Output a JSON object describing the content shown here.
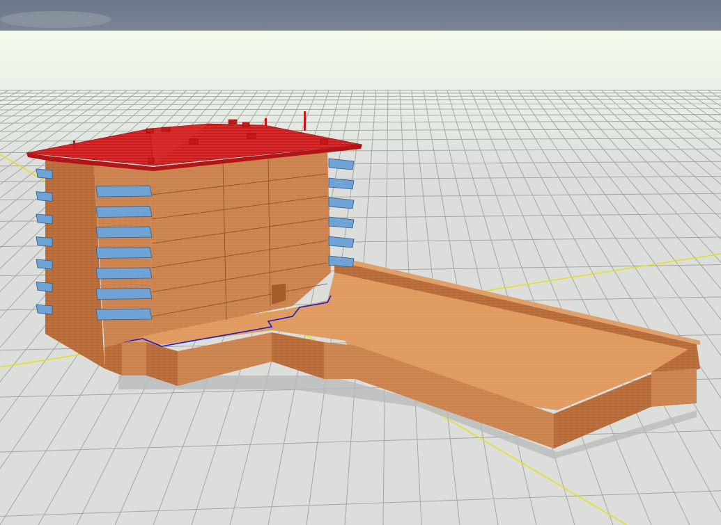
{
  "viewport": {
    "kind": "3d-model-viewer",
    "view": "perspective"
  },
  "colors": {
    "sky": "#6b7a8c",
    "horizon_haze": "#eef7e9",
    "ground": "#dcdedc",
    "grid_line": "#9ea19e",
    "axis_line": "#e8e31a",
    "brick_light": "#d9905a",
    "brick_mid": "#c9773f",
    "brick_dark": "#a9592a",
    "roof": "#cc1a1c",
    "balcony_glass": "#6fa3d6",
    "roof_drain_path": "#1a1acc"
  },
  "scene_objects": [
    {
      "name": "multi-storey-building",
      "icon": "building-icon"
    },
    {
      "name": "pitched-roof",
      "icon": "roof-icon"
    },
    {
      "name": "balconies-left",
      "icon": "balcony-icon"
    },
    {
      "name": "balconies-right",
      "icon": "balcony-icon"
    },
    {
      "name": "podium-annex",
      "icon": "slab-icon"
    },
    {
      "name": "ground-grid",
      "icon": "grid-icon"
    },
    {
      "name": "axis-x",
      "icon": "axis-icon"
    },
    {
      "name": "axis-y",
      "icon": "axis-icon"
    }
  ]
}
